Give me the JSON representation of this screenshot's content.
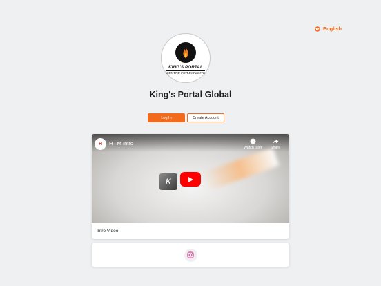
{
  "header": {
    "language_label": "English",
    "language_icon": "globe-icon"
  },
  "brand": {
    "logo_title": "KING'S PORTAL",
    "logo_subtitle": "CENTRE FOR EXPLOITS",
    "site_title": "King's Portal Global"
  },
  "auth": {
    "login_label": "Log In",
    "create_account_label": "Create Account"
  },
  "video": {
    "channel_avatar_text": "H",
    "title": "H I M Intro",
    "watch_later_label": "Watch later",
    "share_label": "Share",
    "caption": "Intro Video"
  },
  "social": {
    "instagram_icon": "instagram-icon"
  },
  "colors": {
    "accent": "#f26b1d",
    "page_background": "#eef0f1",
    "youtube_red": "#ff0000",
    "instagram": "#c13584"
  }
}
